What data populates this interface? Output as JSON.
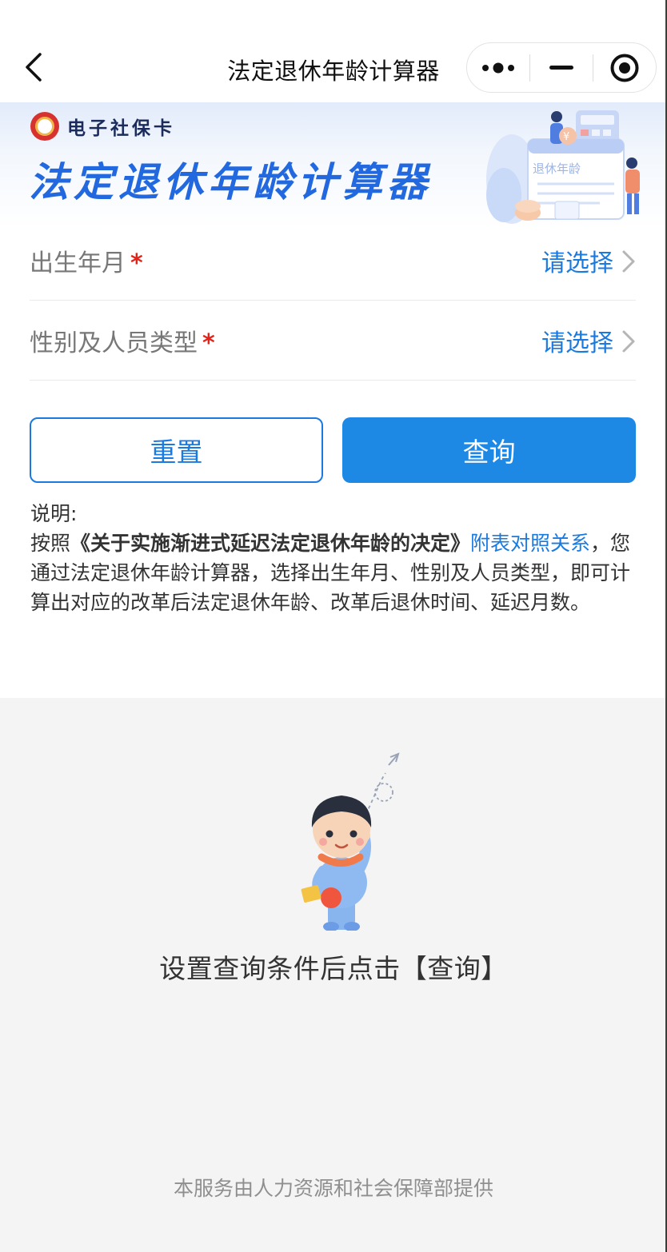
{
  "navbar": {
    "title": "法定退休年龄计算器",
    "back_icon": "chevron-left-icon",
    "more_icon": "more-dots-icon",
    "minimize_icon": "minimize-icon",
    "close_icon": "target-close-icon"
  },
  "banner": {
    "brand_name": "电子社保卡",
    "title": "法定退休年龄计算器",
    "illustration_text": "退休年龄"
  },
  "form": {
    "fields": [
      {
        "label": "出生年月",
        "required_mark": "*",
        "value": "请选择"
      },
      {
        "label": "性别及人员类型",
        "required_mark": "*",
        "value": "请选择"
      }
    ]
  },
  "buttons": {
    "reset_label": "重置",
    "query_label": "查询"
  },
  "notes": {
    "heading": "说明:",
    "prefix": "按照",
    "document": "《关于实施渐进式延迟法定退休年龄的决定》",
    "link": "附表对照关系",
    "suffix": "，您通过法定退休年龄计算器，选择出生年月、性别及人员类型，即可计算出对应的改革后法定退休年龄、改革后退休时间、延迟月数。"
  },
  "result": {
    "empty_text": "设置查询条件后点击【查询】"
  },
  "footer": {
    "text": "本服务由人力资源和社会保障部提供"
  },
  "colors": {
    "accent": "#1a7ae0",
    "primary_button": "#1e88e5",
    "banner_title": "#2268df",
    "required": "#e2231a"
  }
}
